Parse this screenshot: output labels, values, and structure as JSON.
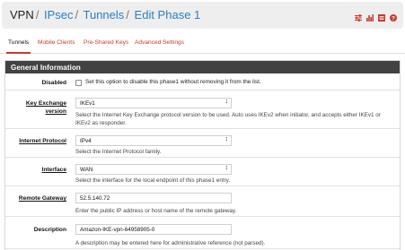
{
  "breadcrumb": {
    "items": [
      "VPN",
      "IPsec",
      "Tunnels",
      "Edit Phase 1"
    ],
    "separator": "/"
  },
  "tabs": [
    "Tunnels",
    "Mobile Clients",
    "Pre-Shared Keys",
    "Advanced Settings"
  ],
  "panel": {
    "title": "General Information"
  },
  "disabled": {
    "label": "Disabled",
    "checkbox_text": "Set this option to disable this phase1 without removing it from the list."
  },
  "key_exchange": {
    "label_line1": "Key Exchange",
    "label_line2": "version",
    "value": "IKEv1",
    "help_line1": "Select the Internet Key Exchange protocol version to be used. Auto uses IKEv2 when initiator, and accepts either IKEv1 or",
    "help_line2": "IKEv2 as responder."
  },
  "internet_protocol": {
    "label": "Internet Protocol",
    "value": "IPv4",
    "help": "Select the Internet Protocol family."
  },
  "interface": {
    "label": "Interface",
    "value": "WAN",
    "help": "Select the interface for the local endpoint of this phase1 entry."
  },
  "remote_gateway": {
    "label": "Remote Gateway",
    "value": "52.5.140.72",
    "help": "Enter the public IP address or host name of the remote gateway."
  },
  "description": {
    "label": "Description",
    "value": "Amazon-IKE-vpn-64958905-0",
    "help": "A description may be entered here for administrative reference (not parsed)."
  },
  "colors": {
    "accent": "#c7392c",
    "link": "#2b7fc3",
    "header_bg": "#424242"
  },
  "icons": [
    "sliders-icon",
    "bar-chart-icon",
    "list-icon",
    "help-icon"
  ]
}
